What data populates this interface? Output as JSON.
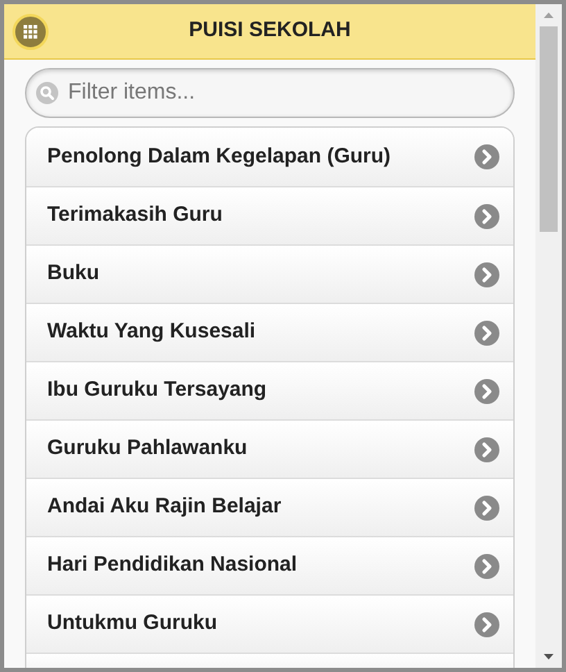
{
  "header": {
    "title": "PUISI SEKOLAH"
  },
  "search": {
    "placeholder": "Filter items..."
  },
  "items": [
    {
      "label": "Penolong Dalam Kegelapan (Guru)"
    },
    {
      "label": "Terimakasih Guru"
    },
    {
      "label": "Buku"
    },
    {
      "label": "Waktu Yang Kusesali"
    },
    {
      "label": "Ibu Guruku Tersayang"
    },
    {
      "label": "Guruku Pahlawanku"
    },
    {
      "label": "Andai Aku Rajin Belajar"
    },
    {
      "label": "Hari Pendidikan Nasional"
    },
    {
      "label": "Untukmu Guruku"
    }
  ]
}
